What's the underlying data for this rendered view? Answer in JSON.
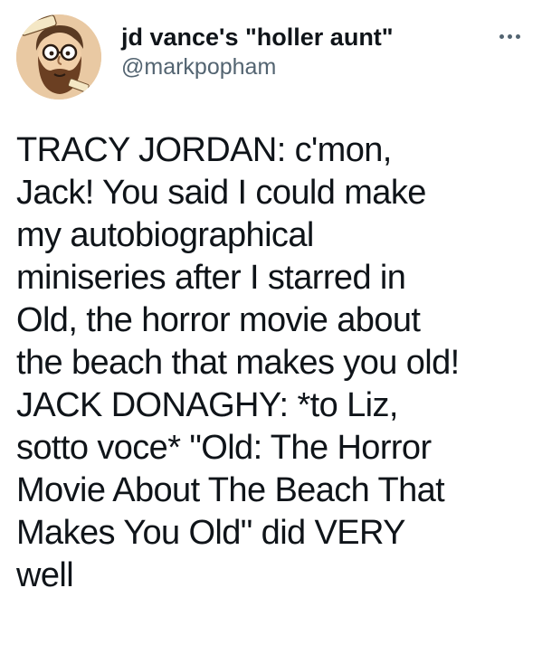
{
  "author": {
    "display_name": "jd vance's \"holler aunt\"",
    "handle": "@markpopham",
    "avatar_icon": "cartoon-bearded-man-avatar"
  },
  "menu": {
    "icon": "more-options-icon"
  },
  "tweet": {
    "text": "TRACY JORDAN: c'mon,\nJack! You said I could make\nmy autobiographical\nminiseries after I starred in\nOld, the horror movie about\nthe beach that makes you old!\nJACK DONAGHY: *to Liz,\nsotto voce* \"Old: The Horror\nMovie About The Beach That\nMakes You Old\" did VERY\nwell"
  },
  "colors": {
    "text": "#0f1419",
    "secondary": "#536471",
    "background": "#ffffff"
  }
}
